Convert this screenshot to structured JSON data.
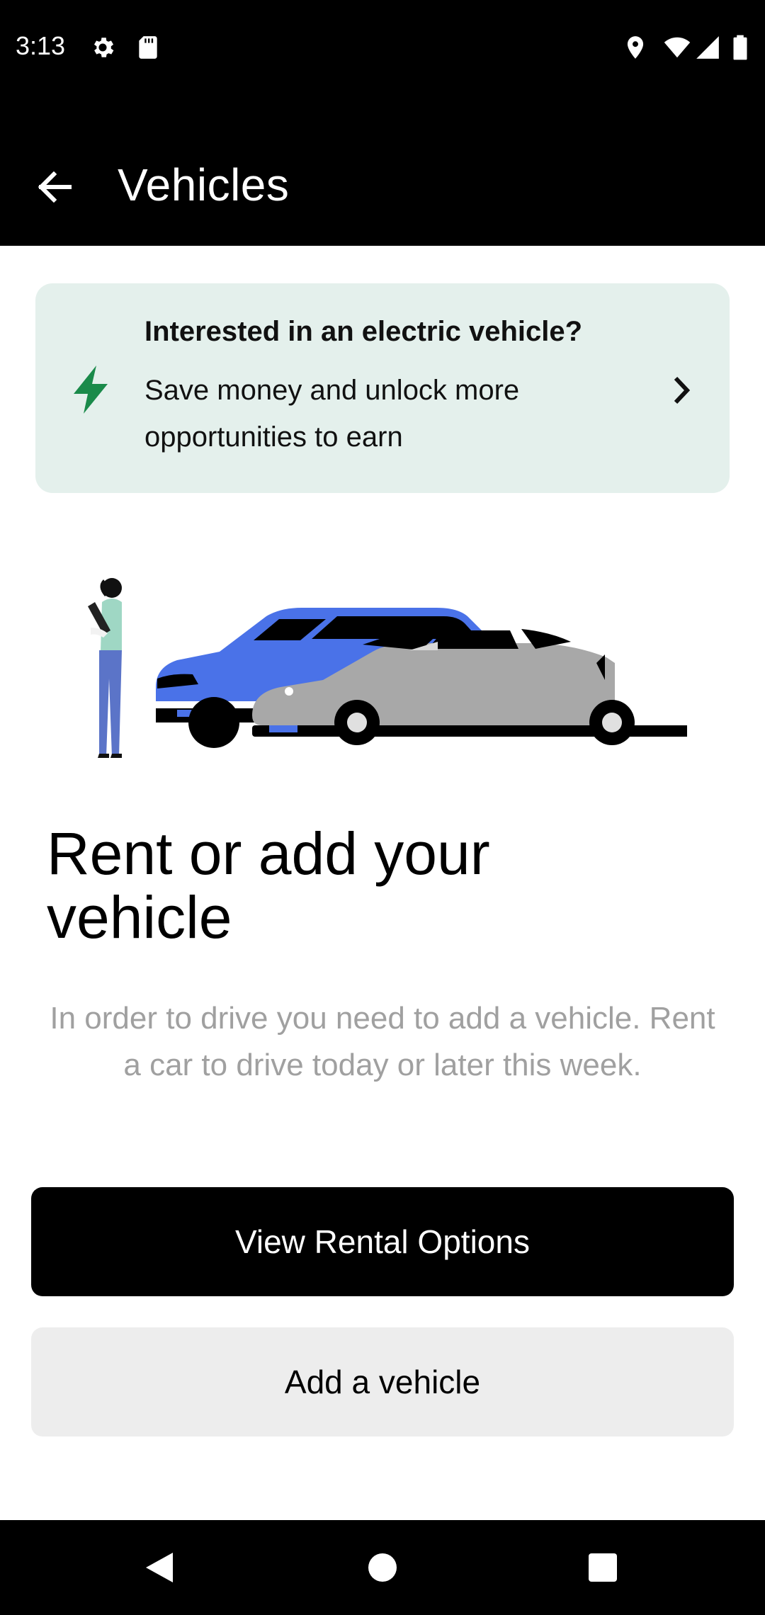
{
  "status_bar": {
    "time": "3:13",
    "icons": [
      "settings-icon",
      "sd-card-icon",
      "location-icon",
      "wifi-icon",
      "signal-icon",
      "battery-icon"
    ]
  },
  "app_bar": {
    "title": "Vehicles",
    "back_icon": "arrow-left-icon"
  },
  "ev_banner": {
    "title": "Interested in an electric vehicle?",
    "description": "Save money and unlock more opportunities to earn",
    "icon": "lightning-bolt-icon",
    "accent_color": "#1a8a4a",
    "background_color": "#e4f0ec"
  },
  "main": {
    "headline": "Rent or add your vehicle",
    "body": "In order to drive you need to add a vehicle. Rent a car to drive today or later this week.",
    "primary_button": "View Rental Options",
    "secondary_button": "Add a vehicle"
  },
  "nav_bar": {
    "icons": [
      "back-triangle-icon",
      "home-circle-icon",
      "recents-square-icon"
    ]
  }
}
